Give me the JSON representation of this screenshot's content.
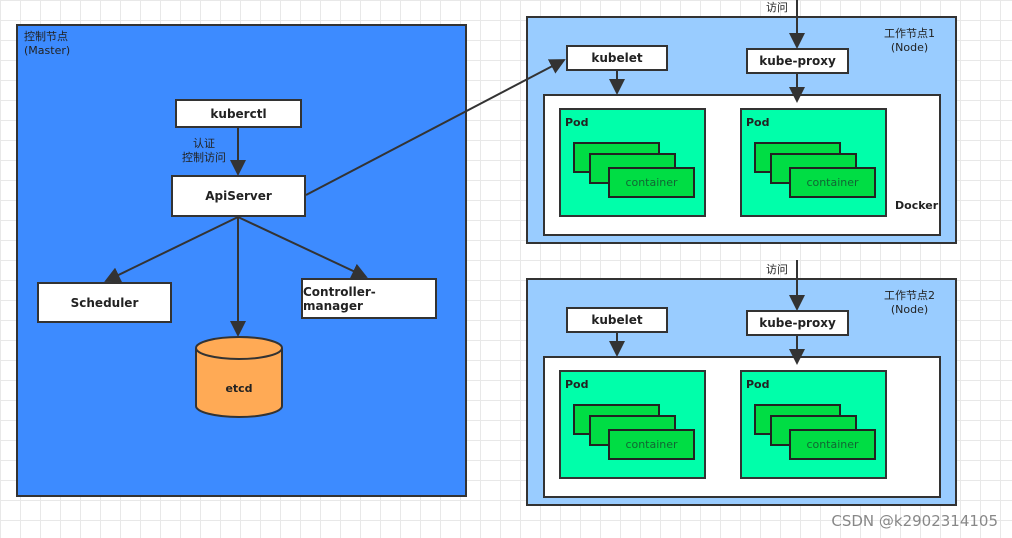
{
  "master": {
    "title": "控制节点\n(Master)",
    "color": "#3d8bff",
    "kuberctl": "kuberctl",
    "auth_label": "认证\n控制访问",
    "apiserver": "ApiServer",
    "scheduler": "Scheduler",
    "controller": "Controller-manager",
    "etcd": "etcd",
    "etcd_color": "#ffaa55"
  },
  "nodes": [
    {
      "title": "工作节点1\n(Node)",
      "access": "访问",
      "kubelet": "kubelet",
      "proxy": "kube-proxy",
      "docker": "Docker",
      "pods": [
        {
          "label": "Pod",
          "container": "container"
        },
        {
          "label": "Pod",
          "container": "container"
        }
      ]
    },
    {
      "title": "工作节点2\n(Node)",
      "access": "访问",
      "kubelet": "kubelet",
      "proxy": "kube-proxy",
      "docker": "",
      "pods": [
        {
          "label": "Pod",
          "container": "container"
        },
        {
          "label": "Pod",
          "container": "container"
        }
      ]
    }
  ],
  "colors": {
    "node": "#99ccff",
    "pod": "#00ffaa",
    "container": "#00dd44"
  },
  "watermark": "CSDN @k2902314105"
}
